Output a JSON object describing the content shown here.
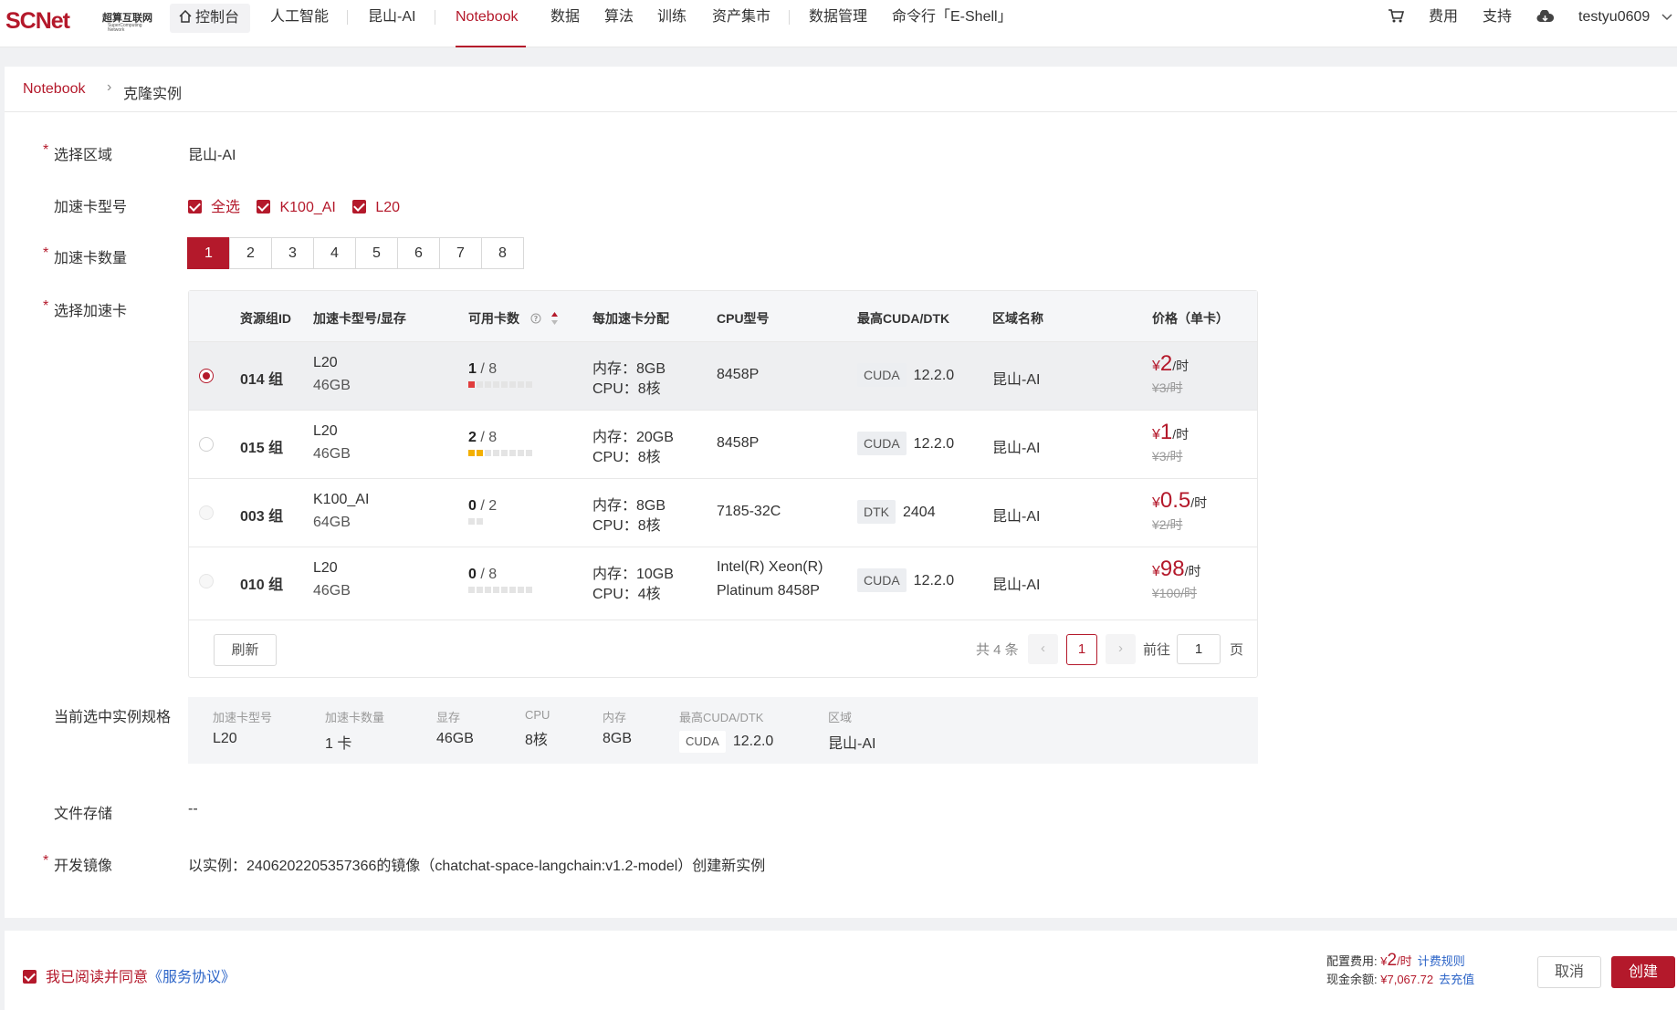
{
  "header": {
    "logo": {
      "main": "SCNet",
      "zh": "超算互联网",
      "en": "SuperComputing Network"
    },
    "home": "控制台",
    "nav": [
      "人工智能",
      "昆山-AI",
      "Notebook",
      "数据",
      "算法",
      "训练",
      "资产集市",
      "数据管理",
      "命令行「E-Shell」"
    ],
    "active_nav": "Notebook",
    "right": {
      "fee": "费用",
      "support": "支持",
      "user": "testyu0609"
    }
  },
  "breadcrumb": {
    "root": "Notebook",
    "current": "克隆实例"
  },
  "form": {
    "region": {
      "label": "选择区域",
      "value": "昆山-AI"
    },
    "card_type": {
      "label": "加速卡型号",
      "options": [
        "全选",
        "K100_AI",
        "L20"
      ]
    },
    "card_count": {
      "label": "加速卡数量",
      "options": [
        "1",
        "2",
        "3",
        "4",
        "5",
        "6",
        "7",
        "8"
      ],
      "selected": "1"
    },
    "select_card": {
      "label": "选择加速卡"
    },
    "spec": {
      "label": "当前选中实例规格"
    },
    "storage": {
      "label": "文件存储",
      "value": "--"
    },
    "image": {
      "label": "开发镜像",
      "value": "以实例：2406202205357366的镜像（chatchat-space-langchain:v1.2-model）创建新实例"
    }
  },
  "table": {
    "headers": [
      "资源组ID",
      "加速卡型号/显存",
      "可用卡数",
      "每加速卡分配",
      "CPU型号",
      "最高CUDA/DTK",
      "区域名称",
      "价格（单卡）"
    ],
    "rows": [
      {
        "group": "014 组",
        "card": "L20",
        "mem": "46GB",
        "avail": "1",
        "total": "/ 8",
        "dots": [
          "red",
          "gray",
          "gray",
          "gray",
          "gray",
          "gray",
          "gray",
          "gray"
        ],
        "alloc_mem": "内存：8GB",
        "alloc_cpu": "CPU：8核",
        "cpu1": "8458P",
        "cpu2": "",
        "tag": "CUDA",
        "ver": "12.2.0",
        "region": "昆山-AI",
        "price": "2",
        "price_old": "¥3/时",
        "state": "selected"
      },
      {
        "group": "015 组",
        "card": "L20",
        "mem": "46GB",
        "avail": "2",
        "total": "/ 8",
        "dots": [
          "yel",
          "yel",
          "gray",
          "gray",
          "gray",
          "gray",
          "gray",
          "gray"
        ],
        "alloc_mem": "内存：20GB",
        "alloc_cpu": "CPU：8核",
        "cpu1": "8458P",
        "cpu2": "",
        "tag": "CUDA",
        "ver": "12.2.0",
        "region": "昆山-AI",
        "price": "1",
        "price_old": "¥3/时",
        "state": "normal"
      },
      {
        "group": "003 组",
        "card": "K100_AI",
        "mem": "64GB",
        "avail": "0",
        "total": "/ 2",
        "dots": [
          "gray",
          "gray"
        ],
        "alloc_mem": "内存：8GB",
        "alloc_cpu": "CPU：8核",
        "cpu1": "7185-32C",
        "cpu2": "",
        "tag": "DTK",
        "ver": "2404",
        "region": "昆山-AI",
        "price": "0.5",
        "price_old": "¥2/时",
        "state": "disabled"
      },
      {
        "group": "010 组",
        "card": "L20",
        "mem": "46GB",
        "avail": "0",
        "total": "/ 8",
        "dots": [
          "gray",
          "gray",
          "gray",
          "gray",
          "gray",
          "gray",
          "gray",
          "gray"
        ],
        "alloc_mem": "内存：10GB",
        "alloc_cpu": "CPU：4核",
        "cpu1": "Intel(R) Xeon(R)",
        "cpu2": "Platinum 8458P",
        "tag": "CUDA",
        "ver": "12.2.0",
        "region": "昆山-AI",
        "price": "98",
        "price_old": "¥100/时",
        "state": "disabled"
      }
    ],
    "refresh": "刷新",
    "pager": {
      "total": "共 4 条",
      "current": "1",
      "goto": "前往",
      "input": "1",
      "page": "页"
    }
  },
  "spec": {
    "items": [
      {
        "k": "加速卡型号",
        "v": "L20"
      },
      {
        "k": "加速卡数量",
        "v": "1 卡"
      },
      {
        "k": "显存",
        "v": "46GB"
      },
      {
        "k": "CPU",
        "v": "8核"
      },
      {
        "k": "内存",
        "v": "8GB"
      },
      {
        "k": "最高CUDA/DTK",
        "tag": "CUDA",
        "v": "12.2.0"
      },
      {
        "k": "区域",
        "v": "昆山-AI"
      }
    ]
  },
  "footer": {
    "agree": "我已阅读并同意",
    "agree_link": "《服务协议》",
    "fee_label": "配置费用:",
    "fee_sym": "¥",
    "fee_val": "2",
    "fee_unit": "/时",
    "fee_rule": "计费规则",
    "balance_label": "现金余额:",
    "balance_val": "¥7,067.72",
    "recharge": "去充值",
    "cancel": "取消",
    "create": "创建"
  },
  "colors": {
    "accent": "#b4192b",
    "link": "#2d65c8"
  }
}
